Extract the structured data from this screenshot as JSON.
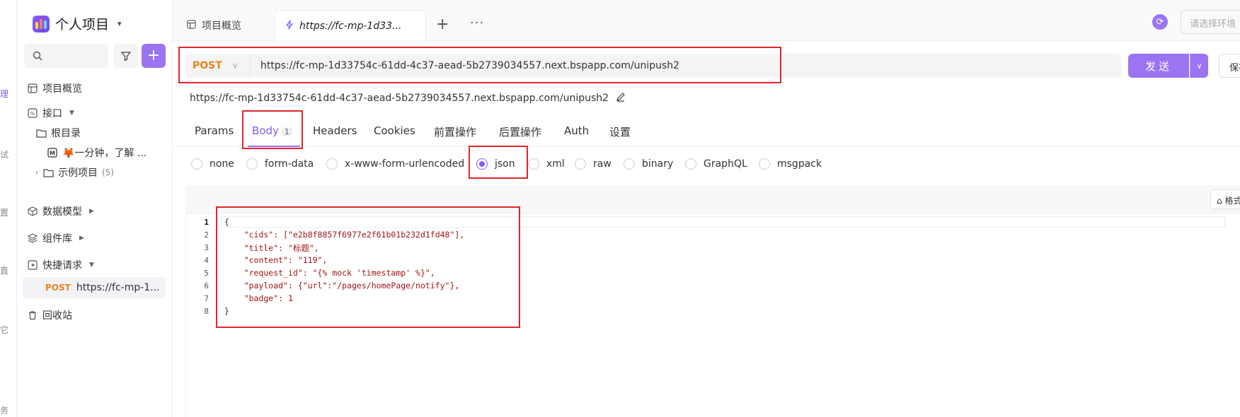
{
  "rail": {
    "chars": [
      "理",
      "试",
      "置",
      "直",
      "它",
      "务"
    ]
  },
  "project": {
    "title": "个人项目",
    "caret": "▾"
  },
  "sidebar": {
    "add_label": "+",
    "overview": "项目概览",
    "interfaces": "接口",
    "root": "根目录",
    "doc_item": "🦊一分钟，了解 ...",
    "examples": "示例项目",
    "examples_count": "(5)",
    "data_model": "数据模型",
    "components": "组件库",
    "quick_requests": "快捷请求",
    "quick_item_method": "POST",
    "quick_item_url": "https://fc-mp-1...",
    "trash": "回收站"
  },
  "tabs": {
    "overview": "项目概览",
    "active": "https://fc-mp-1d33...",
    "plus": "+",
    "more": "···"
  },
  "env": {
    "placeholder": "请选择环境"
  },
  "request": {
    "method": "POST",
    "url": "https://fc-mp-1d33754c-61dd-4c37-aead-5b2739034557.next.bspapp.com/unipush2",
    "send_label": "发送",
    "save_label": "保存",
    "display_url": "https://fc-mp-1d33754c-61dd-4c37-aead-5b2739034557.next.bspapp.com/unipush2"
  },
  "subtabs": {
    "params": "Params",
    "body": "Body",
    "body_count": "1",
    "headers": "Headers",
    "cookies": "Cookies",
    "pre": "前置操作",
    "post": "后置操作",
    "auth": "Auth",
    "settings": "设置"
  },
  "body_types": {
    "none": "none",
    "form_data": "form-data",
    "urlencoded": "x-www-form-urlencoded",
    "json": "json",
    "xml": "xml",
    "raw": "raw",
    "binary": "binary",
    "graphql": "GraphQL",
    "msgpack": "msgpack",
    "selected": "json"
  },
  "editor": {
    "format_label": "格式化",
    "line_numbers": [
      "1",
      "2",
      "3",
      "4",
      "5",
      "6",
      "7",
      "8"
    ],
    "lines": [
      "{",
      "    \"cids\": [\"e2b8f8857f6977e2f61b01b232d1fd48\"],",
      "    \"title\": \"标题\",",
      "    \"content\": \"119\",",
      "    \"request_id\": \"{% mock 'timestamp' %}\",",
      "    \"payload\": {\"url\":\"/pages/homePage/notify\"},",
      "    \"badge\": 1",
      "}"
    ]
  },
  "colors": {
    "accent": "#9b74f2",
    "post": "#e8811a",
    "annotation": "#e0262a"
  }
}
